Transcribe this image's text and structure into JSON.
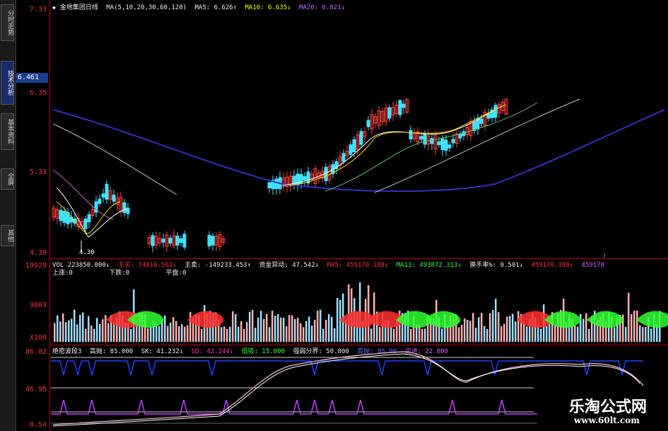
{
  "sidebar": {
    "tabs": [
      {
        "label": "分时走势",
        "active": false
      },
      {
        "label": "技术分析",
        "active": true
      },
      {
        "label": "基本资料",
        "active": false
      },
      {
        "label": "全屏",
        "active": false
      },
      {
        "label": "其他",
        "active": false
      }
    ]
  },
  "price_panel": {
    "stock_name": "金地集团日线",
    "ma_legend": "MA(5,10,20,30,60,120)",
    "ma5": "MA5: 6.626↑",
    "ma10": "MA10: 6.635↓",
    "ma20": "MA20: 6.821↓",
    "y_ticks": [
      "7.33",
      "6.35",
      "5.33",
      "4.30"
    ],
    "current_price": "6.461",
    "low_label": "4.30"
  },
  "volume_panel": {
    "header": [
      "VOL 223850.000↓",
      "主买: 74816.563↓",
      "主卖: -149233.453↑",
      "资金异动: 47.542↓",
      "MA5: 459170.188↓",
      "MA13: 493872.313↓",
      "换手率%: 0.501↓",
      "459170.188↓",
      "459170"
    ],
    "subheader": [
      "上涨:0",
      "下跌:0",
      "平盘:0"
    ],
    "y_ticks": [
      "19929",
      "9803",
      "X100"
    ]
  },
  "indicator_panel": {
    "header": [
      "绝密波段3",
      "高抛: 85.000",
      "SK: 41.232↓",
      "SD: 42.244↓",
      "低吸: 15.000",
      "强弱分界: 50.000",
      "高抛: 85.00",
      "买进: 22.000"
    ],
    "y_ticks": [
      "86.02",
      "46.95",
      "8.54"
    ]
  },
  "watermark": {
    "title": "乐淘公式网",
    "url": "www.60lt.com"
  },
  "colors": {
    "up": "#ff4040",
    "down": "#40e0ff",
    "axis": "#b00000"
  }
}
